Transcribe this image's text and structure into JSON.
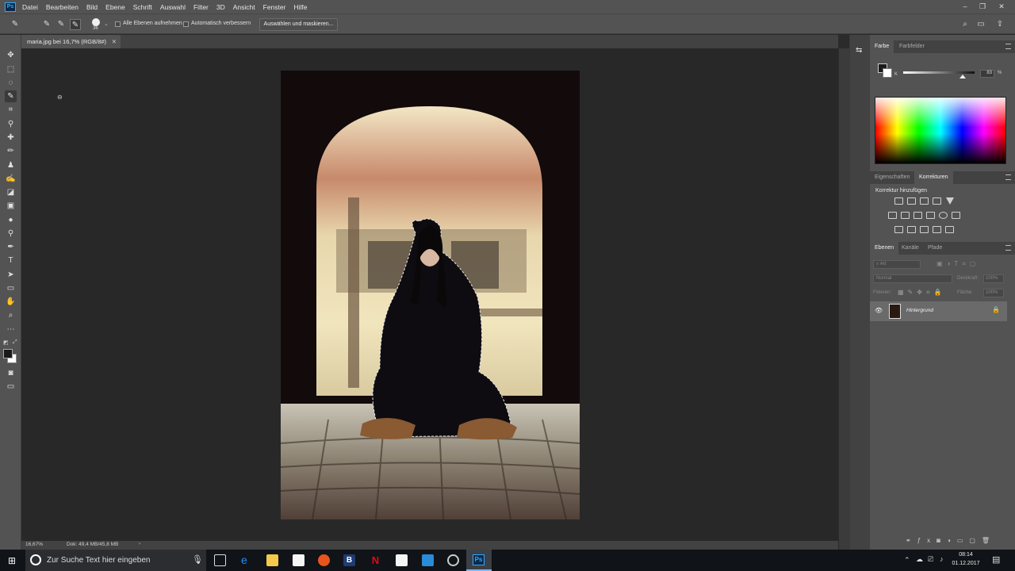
{
  "app": {
    "logo": "Ps",
    "menus": [
      "Datei",
      "Bearbeiten",
      "Bild",
      "Ebene",
      "Schrift",
      "Auswahl",
      "Filter",
      "3D",
      "Ansicht",
      "Fenster",
      "Hilfe"
    ]
  },
  "options_bar": {
    "brush_size": "36",
    "sample_all_layers_label": "Alle Ebenen aufnehmen",
    "auto_enhance_label": "Automatisch verbessern",
    "select_and_mask_label": "Auswählen und maskieren..."
  },
  "document": {
    "tab_title": "maria.jpg bei 16,7% (RGB/8#)",
    "zoom": "16,67%",
    "doc_size": "Dok: 49,4 MB/45,8 MB"
  },
  "color_panel": {
    "tabs": [
      "Farbe",
      "Farbfelder"
    ],
    "channel_label": "K",
    "value": "83",
    "unit": "%"
  },
  "adjustments_panel": {
    "tabs": [
      "Eigenschaften",
      "Korrekturen"
    ],
    "heading": "Korrektur hinzufügen"
  },
  "layers_panel": {
    "tabs": [
      "Ebenen",
      "Kanäle",
      "Pfade"
    ],
    "filter_placeholder": "Art",
    "blend_mode": "Normal",
    "opacity_label": "Deckkraft:",
    "opacity_value": "100%",
    "lock_label": "Fixieren:",
    "fill_label": "Fläche:",
    "fill_value": "100%",
    "layers": [
      {
        "name": "Hintergrund",
        "visible": true,
        "locked": true
      }
    ]
  },
  "taskbar": {
    "search_placeholder": "Zur Suche Text hier eingeben",
    "time": "08:14",
    "date": "01.12.2017"
  }
}
